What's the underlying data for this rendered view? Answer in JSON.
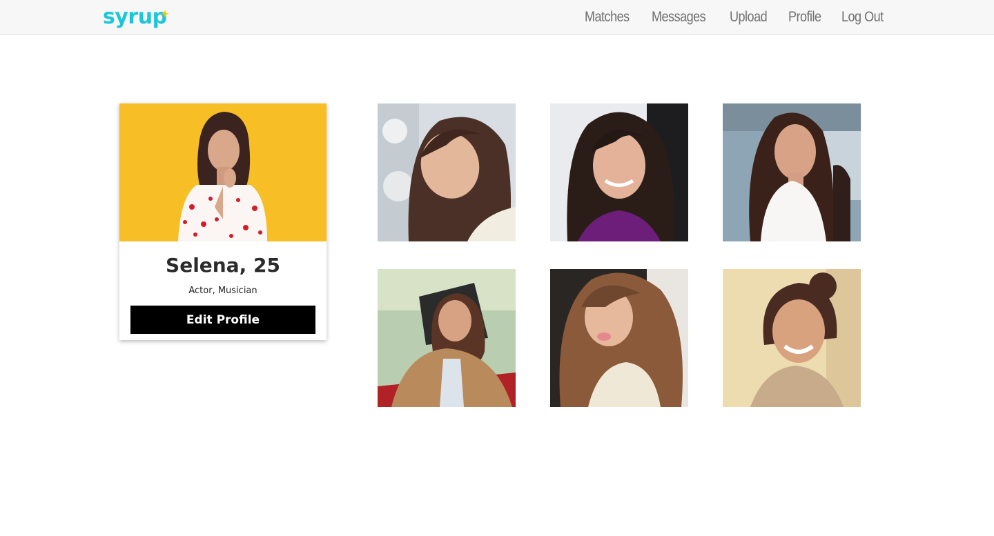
{
  "app": {
    "logo_text": "syrup",
    "brand_color": "#1cc6d9",
    "spark_color": "#f5c400"
  },
  "nav": {
    "items": [
      {
        "label": "Matches"
      },
      {
        "label": "Messages"
      },
      {
        "label": "Upload"
      },
      {
        "label": "Profile"
      },
      {
        "label": "Log Out"
      }
    ]
  },
  "profile": {
    "name_age": "Selena, 25",
    "occupation": "Actor, Musician",
    "edit_button_label": "Edit Profile"
  },
  "gallery": {
    "photos": [
      {
        "icon": "photo-1"
      },
      {
        "icon": "photo-2"
      },
      {
        "icon": "photo-3"
      },
      {
        "icon": "photo-4"
      },
      {
        "icon": "photo-5"
      },
      {
        "icon": "photo-6"
      }
    ]
  }
}
